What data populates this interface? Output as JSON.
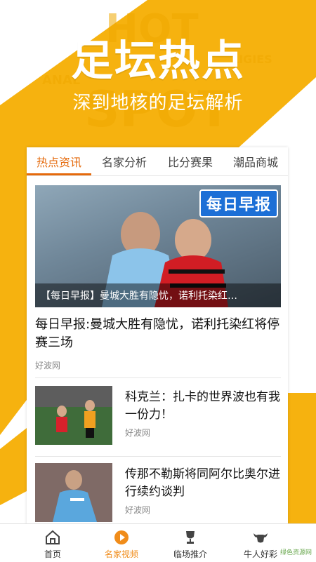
{
  "hero": {
    "title": "足坛热点",
    "subtitle": "深到地核的足坛解析"
  },
  "tabs": [
    "热点资讯",
    "名家分析",
    "比分赛果",
    "潮品商城"
  ],
  "active_tab": "热点资讯",
  "feature": {
    "badge": "每日早报",
    "caption": "【每日早报】曼城大胜有隐忧，诺利托染红…",
    "title": "每日早报:曼城大胜有隐忧，诺利托染红将停赛三场",
    "source": "好波网"
  },
  "news": [
    {
      "title": "科克兰：扎卡的世界波也有我一份力！",
      "source": "好波网"
    },
    {
      "title": "传那不勒斯将同阿尔比奥尔进行续约谈判",
      "source": "好波网"
    }
  ],
  "bottom_nav": [
    {
      "label": "首页",
      "icon": "home-icon"
    },
    {
      "label": "名家视频",
      "icon": "play-icon"
    },
    {
      "label": "临场推介",
      "icon": "trophy-icon"
    },
    {
      "label": "牛人好彩",
      "icon": "bull-icon"
    }
  ],
  "active_nav": "名家视频",
  "watermark": "绿色资源网",
  "colors": {
    "brand_yellow": "#f5b511",
    "accent_orange": "#e56a0c",
    "badge_blue": "#1c6fd6"
  }
}
